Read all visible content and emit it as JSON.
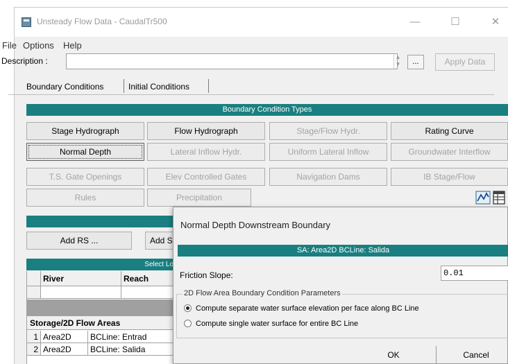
{
  "window": {
    "title": "Unsteady Flow Data - CaudalTr500",
    "minimize": "—",
    "maximize": "☐",
    "close": "✕"
  },
  "menu": [
    "File",
    "Options",
    "Help"
  ],
  "description": {
    "label": "Description :",
    "value": "",
    "dots": "...",
    "apply": "Apply Data"
  },
  "tabs": [
    "Boundary Conditions",
    "Initial Conditions"
  ],
  "bc_types": {
    "header": "Boundary Condition Types",
    "row1": [
      "Stage Hydrograph",
      "Flow Hydrograph",
      "Stage/Flow Hydr.",
      "Rating Curve"
    ],
    "row2": [
      "Normal Depth",
      "Lateral Inflow Hydr.",
      "Uniform Lateral Inflow",
      "Groundwater Interflow"
    ],
    "row3": [
      "T.S. Gate Openings",
      "Elev Controlled Gates",
      "Navigation Dams",
      "IB Stage/Flow"
    ],
    "row4": [
      "Rules",
      "Precipitation"
    ]
  },
  "add_buttons": [
    "Add RS ...",
    "Add S"
  ],
  "grid": {
    "select_header": "Select Lo",
    "col_river": "River",
    "col_reach": "Reach",
    "storage_header": "Storage/2D Flow Areas",
    "rows": [
      {
        "num": "1",
        "area": "Area2D",
        "bc": "BCLine: Entrad"
      },
      {
        "num": "2",
        "area": "Area2D",
        "bc": "BCLine: Salida"
      }
    ]
  },
  "dialog": {
    "title": "Normal Depth Downstream Boundary",
    "sa_bar": "SA: Area2D BCLine: Salida",
    "friction_label": "Friction Slope:",
    "friction_value": "0.01",
    "group_legend": "2D Flow Area Boundary Condition Parameters",
    "option1": "Compute separate water surface elevation per face along BC Line",
    "option2": "Compute single water surface for entire BC Line",
    "selected_option": 1,
    "ok": "OK",
    "cancel": "Cancel"
  },
  "colors": {
    "teal": "#1a7f80",
    "disabled_text": "#a3a3a3"
  }
}
